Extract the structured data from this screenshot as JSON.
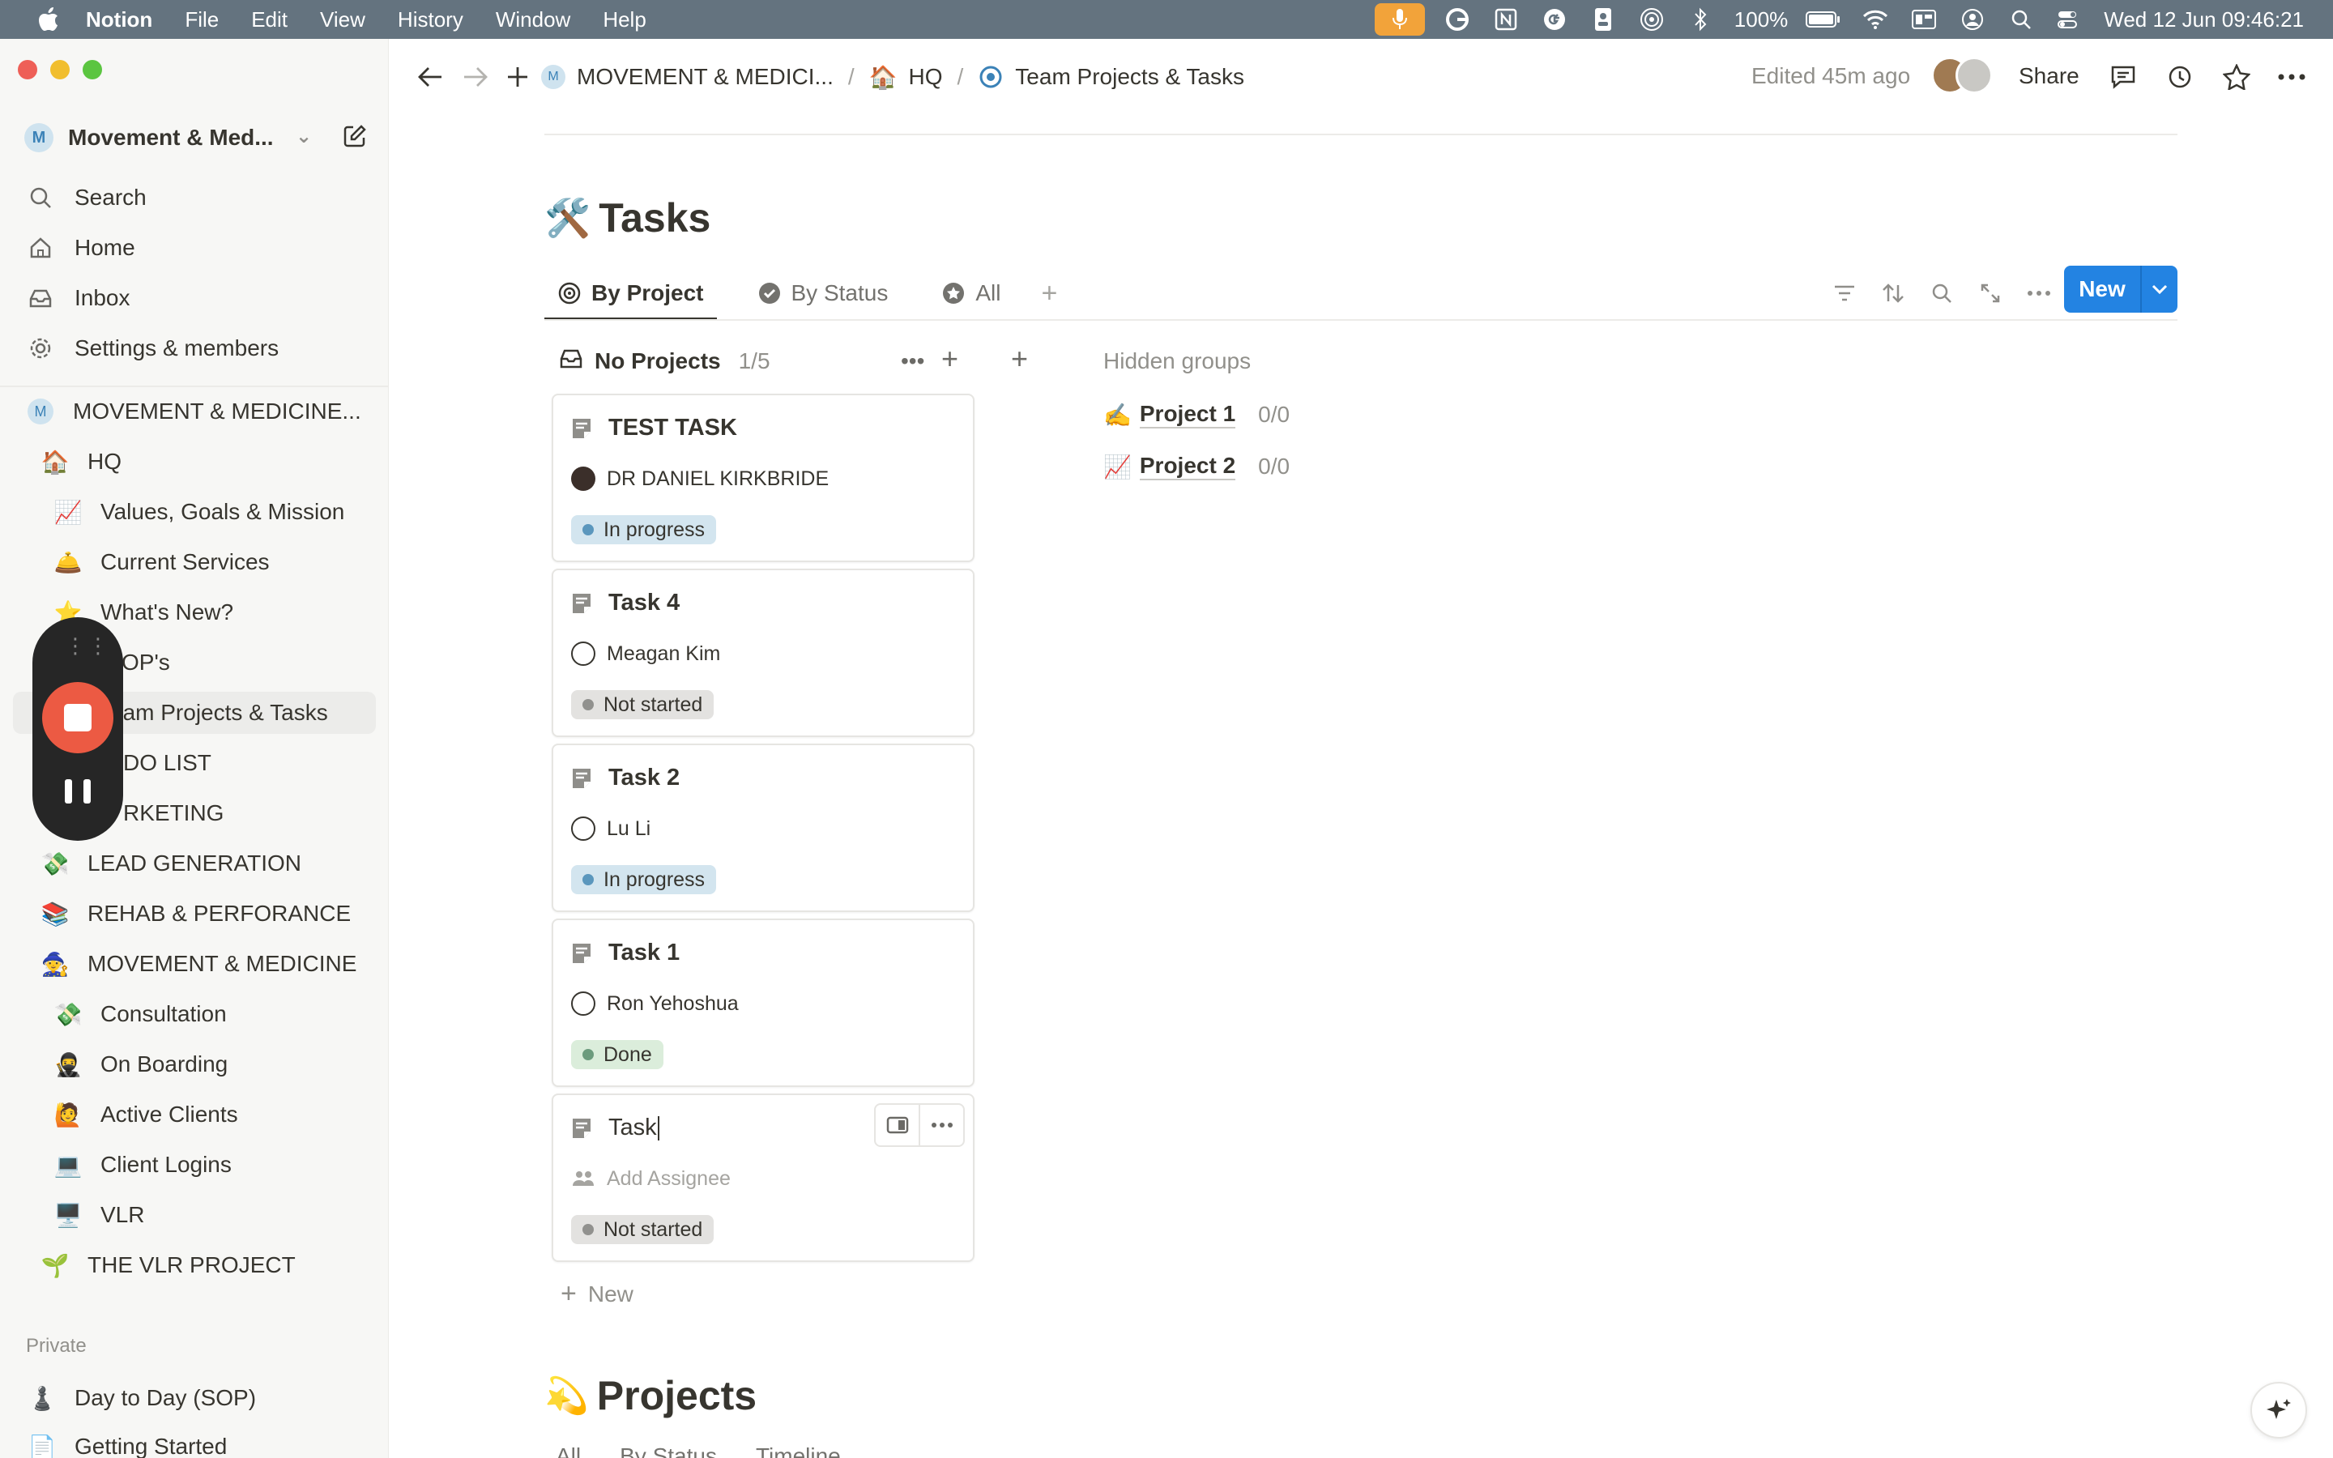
{
  "menubar": {
    "app": "Notion",
    "menus": [
      "File",
      "Edit",
      "View",
      "History",
      "Window",
      "Help"
    ],
    "battery": "100%",
    "datetime": "Wed 12 Jun  09:46:21"
  },
  "sidebar": {
    "workspace": "Movement & Med...",
    "nav": [
      {
        "label": "Search",
        "icon": "search-icon"
      },
      {
        "label": "Home",
        "icon": "home-icon"
      },
      {
        "label": "Inbox",
        "icon": "inbox-icon"
      },
      {
        "label": "Settings & members",
        "icon": "gear-icon"
      }
    ],
    "teamspace": "MOVEMENT & MEDICINE...",
    "tree": [
      {
        "label": "HQ",
        "emoji": "🏠"
      },
      {
        "label": "Values, Goals & Mission",
        "emoji": "📈"
      },
      {
        "label": "Current Services",
        "emoji": "🛎️"
      },
      {
        "label": "What's New?",
        "emoji": "⭐"
      },
      {
        "label": "OP's",
        "emoji": ""
      },
      {
        "label": "eam Projects & Tasks",
        "emoji": ""
      },
      {
        "label": "DO LIST",
        "emoji": ""
      },
      {
        "label": "RKETING",
        "emoji": ""
      },
      {
        "label": "LEAD GENERATION",
        "emoji": "💸"
      },
      {
        "label": "REHAB & PERFORANCE",
        "emoji": "📚"
      },
      {
        "label": "MOVEMENT & MEDICINE",
        "emoji": "🧙"
      },
      {
        "label": "Consultation",
        "emoji": "💸"
      },
      {
        "label": "On Boarding",
        "emoji": "🥷"
      },
      {
        "label": "Active Clients",
        "emoji": "🙋"
      },
      {
        "label": "Client Logins",
        "emoji": "💻"
      },
      {
        "label": "VLR",
        "emoji": "🖥️"
      },
      {
        "label": "THE VLR PROJECT",
        "emoji": "🌱"
      }
    ],
    "private_label": "Private",
    "private": [
      {
        "label": "Day to Day (SOP)",
        "emoji": "♟️"
      },
      {
        "label": "Getting Started",
        "emoji": "📄"
      }
    ]
  },
  "topbar": {
    "breadcrumbs": [
      "MOVEMENT & MEDICI...",
      "HQ",
      "Team Projects & Tasks"
    ],
    "edited": "Edited 45m ago",
    "share": "Share"
  },
  "database": {
    "emoji": "🛠️",
    "title": "Tasks",
    "tabs": [
      "By Project",
      "By Status",
      "All"
    ],
    "new_label": "New",
    "column": {
      "name": "No Projects",
      "count": "1/5"
    },
    "cards": [
      {
        "title": "TEST TASK",
        "assignee": "DR DANIEL KIRKBRIDE",
        "status": "In progress"
      },
      {
        "title": "Task 4",
        "assignee": "Meagan Kim",
        "status": "Not started"
      },
      {
        "title": "Task 2",
        "assignee": "Lu Li",
        "status": "In progress"
      },
      {
        "title": "Task 1",
        "assignee": "Ron Yehoshua",
        "status": "Done"
      },
      {
        "title": "Task",
        "assignee": "Add Assignee",
        "status": "Not started"
      }
    ],
    "add_new": "New",
    "hidden_label": "Hidden groups",
    "hidden_groups": [
      {
        "emoji": "✍️",
        "name": "Project 1",
        "count": "0/0"
      },
      {
        "emoji": "📈",
        "name": "Project 2",
        "count": "0/0"
      }
    ]
  },
  "projects": {
    "emoji": "💫",
    "title": "Projects",
    "tabs": [
      "All",
      "By Status",
      "Timeline"
    ]
  },
  "colors": {
    "accent": "#2383e2",
    "menubar": "#64737f",
    "recorder_stop": "#ec5a43"
  }
}
